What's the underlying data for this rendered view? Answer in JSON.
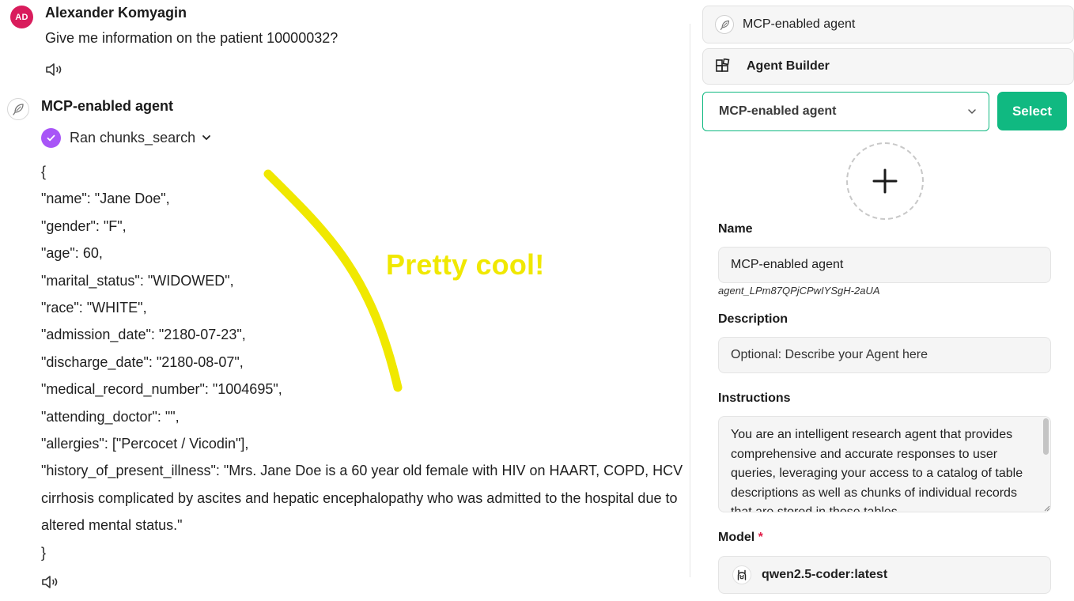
{
  "chat": {
    "user": {
      "avatar_initials": "AD",
      "name": "Alexander Komyagin",
      "message": "Give me information on the patient 10000032?"
    },
    "agent": {
      "name": "MCP-enabled agent",
      "tool_call": "Ran chunks_search",
      "response_lines": [
        "{",
        "\"name\": \"Jane Doe\",",
        "\"gender\": \"F\",",
        "\"age\": 60,",
        "\"marital_status\": \"WIDOWED\",",
        "\"race\": \"WHITE\",",
        "\"admission_date\": \"2180-07-23\",",
        "\"discharge_date\": \"2180-08-07\",",
        "\"medical_record_number\": \"1004695\",",
        "\"attending_doctor\": \"\",",
        "\"allergies\": [\"Percocet / Vicodin\"],",
        "\"history_of_present_illness\": \"Mrs. Jane Doe is a 60 year old female with HIV on HAART, COPD, HCV cirrhosis complicated by ascites and hepatic encephalopathy who was admitted to the hospital due to altered mental status.\"",
        "}"
      ]
    },
    "annotation": "Pretty cool!"
  },
  "panel": {
    "agent_tab_label": "MCP-enabled agent",
    "builder_tab_label": "Agent Builder",
    "selected_agent": "MCP-enabled agent",
    "select_button": "Select",
    "name_label": "Name",
    "name_value": "MCP-enabled agent",
    "agent_id": "agent_LPm87QPjCPwIYSgH-2aUA",
    "description_label": "Description",
    "description_placeholder": "Optional: Describe your Agent here",
    "instructions_label": "Instructions",
    "instructions_value": "You are an intelligent research agent that provides comprehensive and accurate responses to user queries, leveraging your access to a catalog of table descriptions as well as chunks of individual records that are stored in those tables.",
    "model_label": "Model",
    "model_required_mark": "*",
    "model_value": "qwen2.5-coder:latest"
  },
  "colors": {
    "accent": "#10b981",
    "avatar": "#d91c5c",
    "tool_check": "#a855f7",
    "annotation": "#f0e800"
  },
  "icons": [
    "speaker-icon",
    "feather-icon",
    "check-icon",
    "chevron-down-icon",
    "blocks-icon",
    "plus-icon",
    "llama-icon"
  ]
}
